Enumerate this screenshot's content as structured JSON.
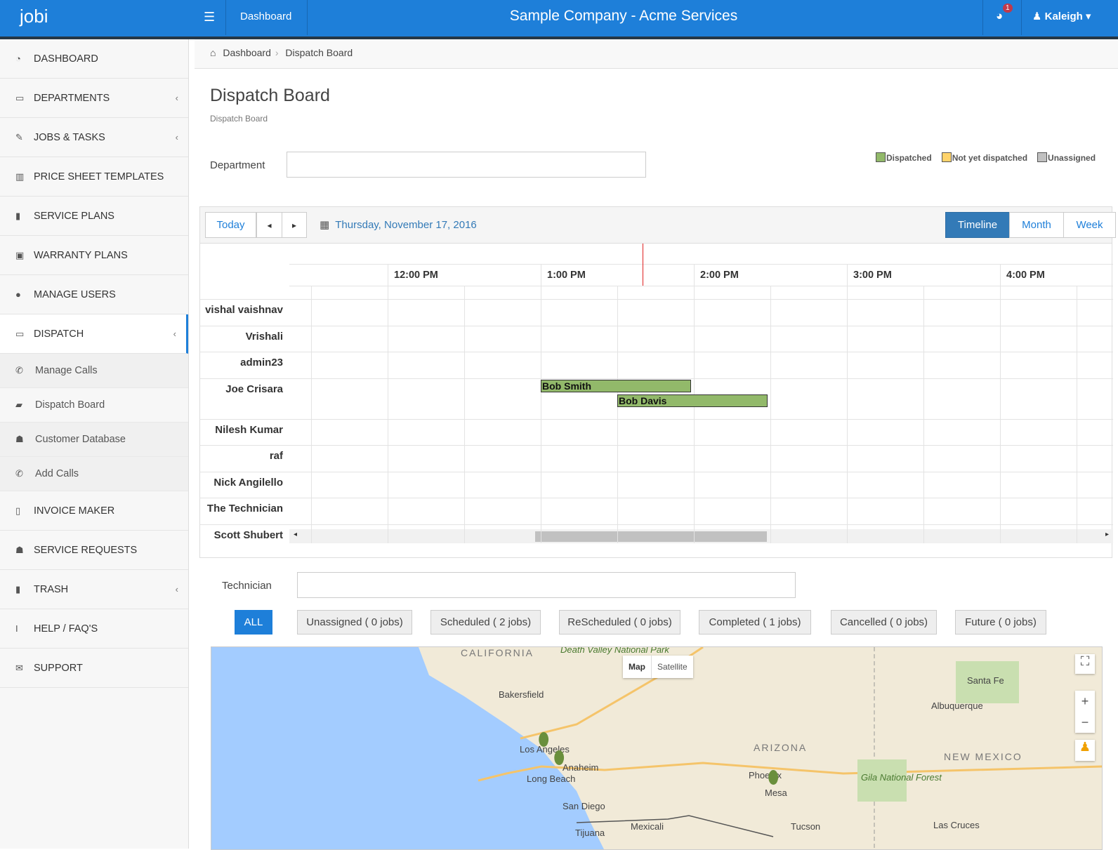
{
  "topbar": {
    "brand": "jobi",
    "nav": "Dashboard",
    "title": "Sample Company - Acme Services",
    "notifications": "1",
    "user": "Kaleigh"
  },
  "sidebar": {
    "items": [
      {
        "label": "Dashboard",
        "icon": "dashboard-icon",
        "glyph": "◔"
      },
      {
        "label": "Departments",
        "icon": "monitor-icon",
        "glyph": "▭",
        "chev": "‹"
      },
      {
        "label": "Jobs & Tasks",
        "icon": "edit-icon",
        "glyph": "✎",
        "chev": "‹"
      },
      {
        "label": "Price Sheet Templates",
        "icon": "bar-chart-icon",
        "glyph": "▥"
      },
      {
        "label": "Service Plans",
        "icon": "briefcase-icon",
        "glyph": "▮"
      },
      {
        "label": "Warranty Plans",
        "icon": "calendar-icon",
        "glyph": "▣"
      },
      {
        "label": "Manage Users",
        "icon": "user-icon",
        "glyph": "●"
      },
      {
        "label": "Dispatch",
        "icon": "monitor-icon",
        "glyph": "▭",
        "chev": "‹"
      }
    ],
    "sub": [
      {
        "label": "Manage Calls",
        "glyph": "✆"
      },
      {
        "label": "Dispatch Board",
        "glyph": "▰"
      },
      {
        "label": "Customer Database",
        "glyph": "☗"
      },
      {
        "label": "Add Calls",
        "glyph": "✆"
      }
    ],
    "items2": [
      {
        "label": "Invoice Maker",
        "icon": "file-icon",
        "glyph": "▯"
      },
      {
        "label": "Service Requests",
        "icon": "users-icon",
        "glyph": "☗"
      },
      {
        "label": "Trash",
        "icon": "trash-icon",
        "glyph": "▮",
        "chev": "‹"
      },
      {
        "label": "Help / FAQ's",
        "icon": "info-icon",
        "glyph": "i"
      },
      {
        "label": "Support",
        "icon": "envelope-icon",
        "glyph": "✉"
      }
    ]
  },
  "breadcrumb": {
    "home": "Dashboard",
    "current": "Dispatch Board"
  },
  "page": {
    "title": "Dispatch Board",
    "subtitle": "Dispatch Board",
    "department_label": "Department",
    "department_value": ""
  },
  "legend": [
    {
      "label": "Dispatched",
      "color": "#92b96a"
    },
    {
      "label": "Not yet dispatched",
      "color": "#ffd36b"
    },
    {
      "label": "Unassigned",
      "color": "#c0c0c0"
    }
  ],
  "calendar": {
    "today": "Today",
    "prev": "◂",
    "next": "▸",
    "date": "Thursday, November 17, 2016",
    "views": [
      "Timeline",
      "Month",
      "Week"
    ],
    "hours": [
      "12:00 PM",
      "1:00 PM",
      "2:00 PM",
      "3:00 PM",
      "4:00 PM"
    ],
    "now": "13:40",
    "rows": [
      {
        "name": "vishal vaishnav"
      },
      {
        "name": "Vrishali"
      },
      {
        "name": "admin23"
      },
      {
        "name": "Joe Crisara",
        "tall": true
      },
      {
        "name": "Nilesh Kumar"
      },
      {
        "name": "raf"
      },
      {
        "name": "Nick Angilello"
      },
      {
        "name": "The Technician"
      },
      {
        "name": "Scott Shubert"
      }
    ],
    "events": [
      {
        "title": "Bob Smith",
        "row": 3,
        "lane": 0,
        "start": 13.0,
        "end": 13.98,
        "color": "#92b96a"
      },
      {
        "title": "Bob Davis",
        "row": 3,
        "lane": 1,
        "start": 13.5,
        "end": 14.48,
        "color": "#92b96a"
      }
    ]
  },
  "filters": {
    "technician_label": "Technician",
    "technician_value": "",
    "buttons": [
      "ALL",
      "Unassigned ( 0 jobs)",
      "Scheduled ( 2 jobs)",
      "ReScheduled ( 0 jobs)",
      "Completed ( 1 jobs)",
      "Cancelled ( 0 jobs)",
      "Future ( 0 jobs)"
    ]
  },
  "map": {
    "type_map": "Map",
    "type_satellite": "Satellite",
    "labels": [
      "CALIFORNIA",
      "Death Valley National Park",
      "Bakersfield",
      "Los Angeles",
      "Anaheim",
      "Long Beach",
      "San Diego",
      "Tijuana",
      "Mexicali",
      "ARIZONA",
      "Phoenix",
      "Mesa",
      "Tucson",
      "NEW MEXICO",
      "Albuquerque",
      "Santa Fe",
      "Gila National Forest",
      "Las Cruces"
    ]
  }
}
